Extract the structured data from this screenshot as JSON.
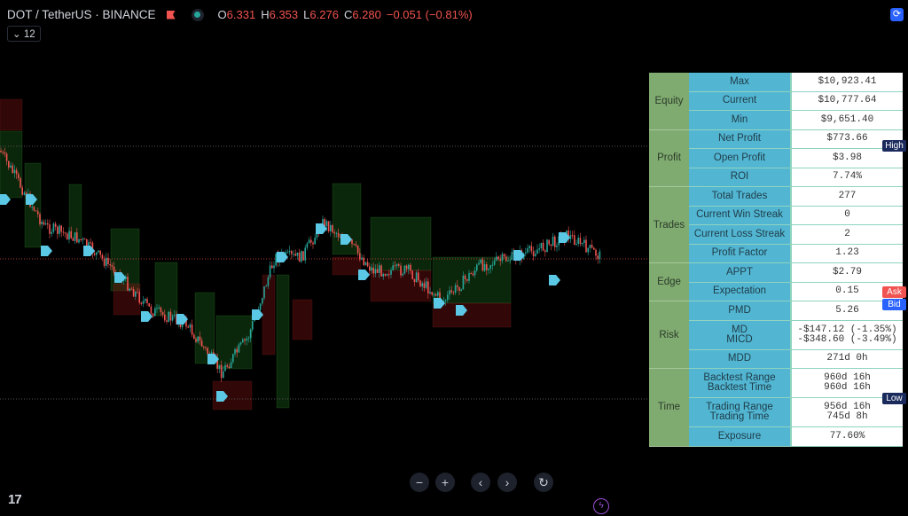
{
  "header": {
    "symbol": "DOT / TetherUS · BINANCE",
    "open_label": "O",
    "open": "6.331",
    "high_label": "H",
    "high": "6.353",
    "low_label": "L",
    "low": "6.276",
    "close_label": "C",
    "close": "6.280",
    "change": "−0.051 (−0.81%)",
    "interval": "12",
    "interval_icon": "chevron-down-icon"
  },
  "price_tags": {
    "high": "High",
    "ask": "Ask",
    "bid": "Bid",
    "low": "Low"
  },
  "colors": {
    "up": "#26a69a",
    "down": "#f05350",
    "high_tag": "#1a2a5c",
    "ask": "#f05350",
    "bid": "#2962ff",
    "group_bg": "#80ab70",
    "label_bg": "#52b6d2"
  },
  "stats": {
    "groups": [
      {
        "name": "Equity",
        "rows": [
          [
            "Max",
            "$10,923.41"
          ],
          [
            "Current",
            "$10,777.64"
          ],
          [
            "Min",
            "$9,651.40"
          ]
        ]
      },
      {
        "name": "Profit",
        "rows": [
          [
            "Net Profit",
            "$773.66"
          ],
          [
            "Open Profit",
            "$3.98"
          ],
          [
            "ROI",
            "7.74%"
          ]
        ]
      },
      {
        "name": "Trades",
        "rows": [
          [
            "Total Trades",
            "277"
          ],
          [
            "Current Win Streak",
            "0"
          ],
          [
            "Current Loss Streak",
            "2"
          ],
          [
            "Profit Factor",
            "1.23"
          ]
        ]
      },
      {
        "name": "Edge",
        "rows": [
          [
            "APPT",
            "$2.79"
          ],
          [
            "Expectation",
            "0.15"
          ]
        ]
      },
      {
        "name": "Risk",
        "rows": [
          [
            "PMD",
            "5.26"
          ],
          [
            "MD\nMICD",
            "-$147.12 (-1.35%)\n-$348.60 (-3.49%)"
          ],
          [
            "MDD",
            "271d 0h"
          ]
        ]
      },
      {
        "name": "Time",
        "rows": [
          [
            "Backtest Range\nBacktest Time",
            "960d 16h\n960d 16h"
          ],
          [
            "Trading Range\nTrading Time",
            "956d 16h\n745d 8h"
          ],
          [
            "Exposure",
            "77.60%"
          ]
        ]
      }
    ]
  },
  "controls": {
    "zoom_out": "−",
    "zoom_in": "+",
    "scroll_left": "‹",
    "scroll_right": "›",
    "reset": "↻",
    "bolt": "ϟ",
    "logo": "17"
  }
}
